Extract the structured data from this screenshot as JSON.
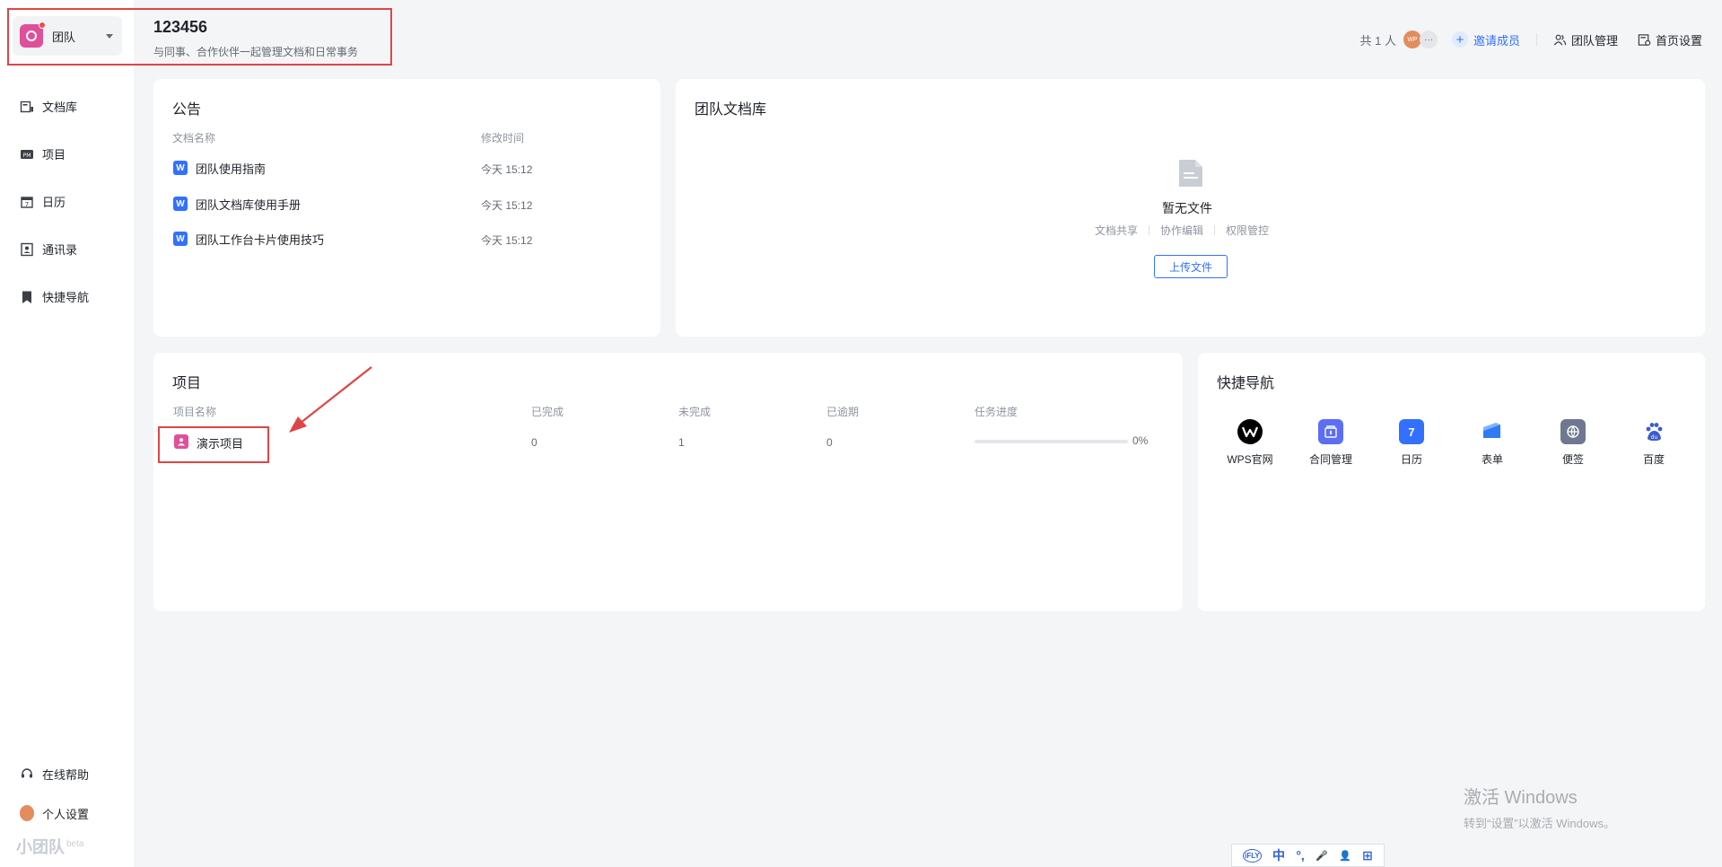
{
  "sidebar": {
    "team_switch": {
      "label": "团队"
    },
    "items": [
      {
        "label": "文档库",
        "icon": "doc-library-icon"
      },
      {
        "label": "项目",
        "icon": "pm-icon"
      },
      {
        "label": "日历",
        "icon": "calendar-icon"
      },
      {
        "label": "通讯录",
        "icon": "contacts-icon"
      },
      {
        "label": "快捷导航",
        "icon": "bookmark-icon"
      }
    ],
    "bottom": [
      {
        "label": "在线帮助",
        "icon": "headset-icon"
      },
      {
        "label": "个人设置",
        "icon": "avatar-icon"
      }
    ],
    "brand": {
      "name": "小团队",
      "tag": "beta"
    }
  },
  "header": {
    "title": "123456",
    "subtitle": "与同事、合作伙伴一起管理文档和日常事务",
    "member_count": "共 1 人",
    "avatar_text": "WP",
    "more": "···",
    "invite_label": "邀请成员",
    "team_manage_label": "团队管理",
    "home_settings_label": "首页设置"
  },
  "announcement": {
    "title": "公告",
    "col_name": "文档名称",
    "col_time": "修改时间",
    "file_icon_letter": "W",
    "rows": [
      {
        "name": "团队使用指南",
        "time": "今天 15:12"
      },
      {
        "name": "团队文档库使用手册",
        "time": "今天 15:12"
      },
      {
        "name": "团队工作台卡片使用技巧",
        "time": "今天 15:12"
      }
    ]
  },
  "library": {
    "title": "团队文档库",
    "empty_title": "暂无文件",
    "tags": [
      "文档共享",
      "协作编辑",
      "权限管控"
    ],
    "upload_label": "上传文件"
  },
  "projects": {
    "title": "项目",
    "columns": {
      "name": "项目名称",
      "done": "已完成",
      "undone": "未完成",
      "overdue": "已逾期",
      "progress": "任务进度"
    },
    "rows": [
      {
        "name": "演示项目",
        "done": "0",
        "undone": "1",
        "overdue": "0",
        "progress_label": "0%",
        "progress": 0
      }
    ]
  },
  "quick_nav": {
    "title": "快捷导航",
    "items": [
      {
        "label": "WPS官网",
        "icon": "wps-icon",
        "color": "#000000"
      },
      {
        "label": "合同管理",
        "icon": "contract-icon",
        "color": "#5b6ef5"
      },
      {
        "label": "日历",
        "icon": "calendar-icon",
        "color": "#3370ff",
        "glyph": "7"
      },
      {
        "label": "表单",
        "icon": "form-icon",
        "color": "#2f7bf6"
      },
      {
        "label": "便签",
        "icon": "note-icon",
        "color": "#6e7891"
      },
      {
        "label": "百度",
        "icon": "baidu-icon",
        "color": "#3b5ccf"
      }
    ]
  },
  "watermark": {
    "line1": "激活 Windows",
    "line2": "转到“设置”以激活 Windows。"
  },
  "ime": {
    "items": [
      "iFLY",
      "中",
      "°,",
      "🎤",
      "👤",
      "⊞"
    ]
  },
  "colors": {
    "accent": "#3370ff",
    "team": "#e04f9a",
    "highlight": "#e04545"
  }
}
